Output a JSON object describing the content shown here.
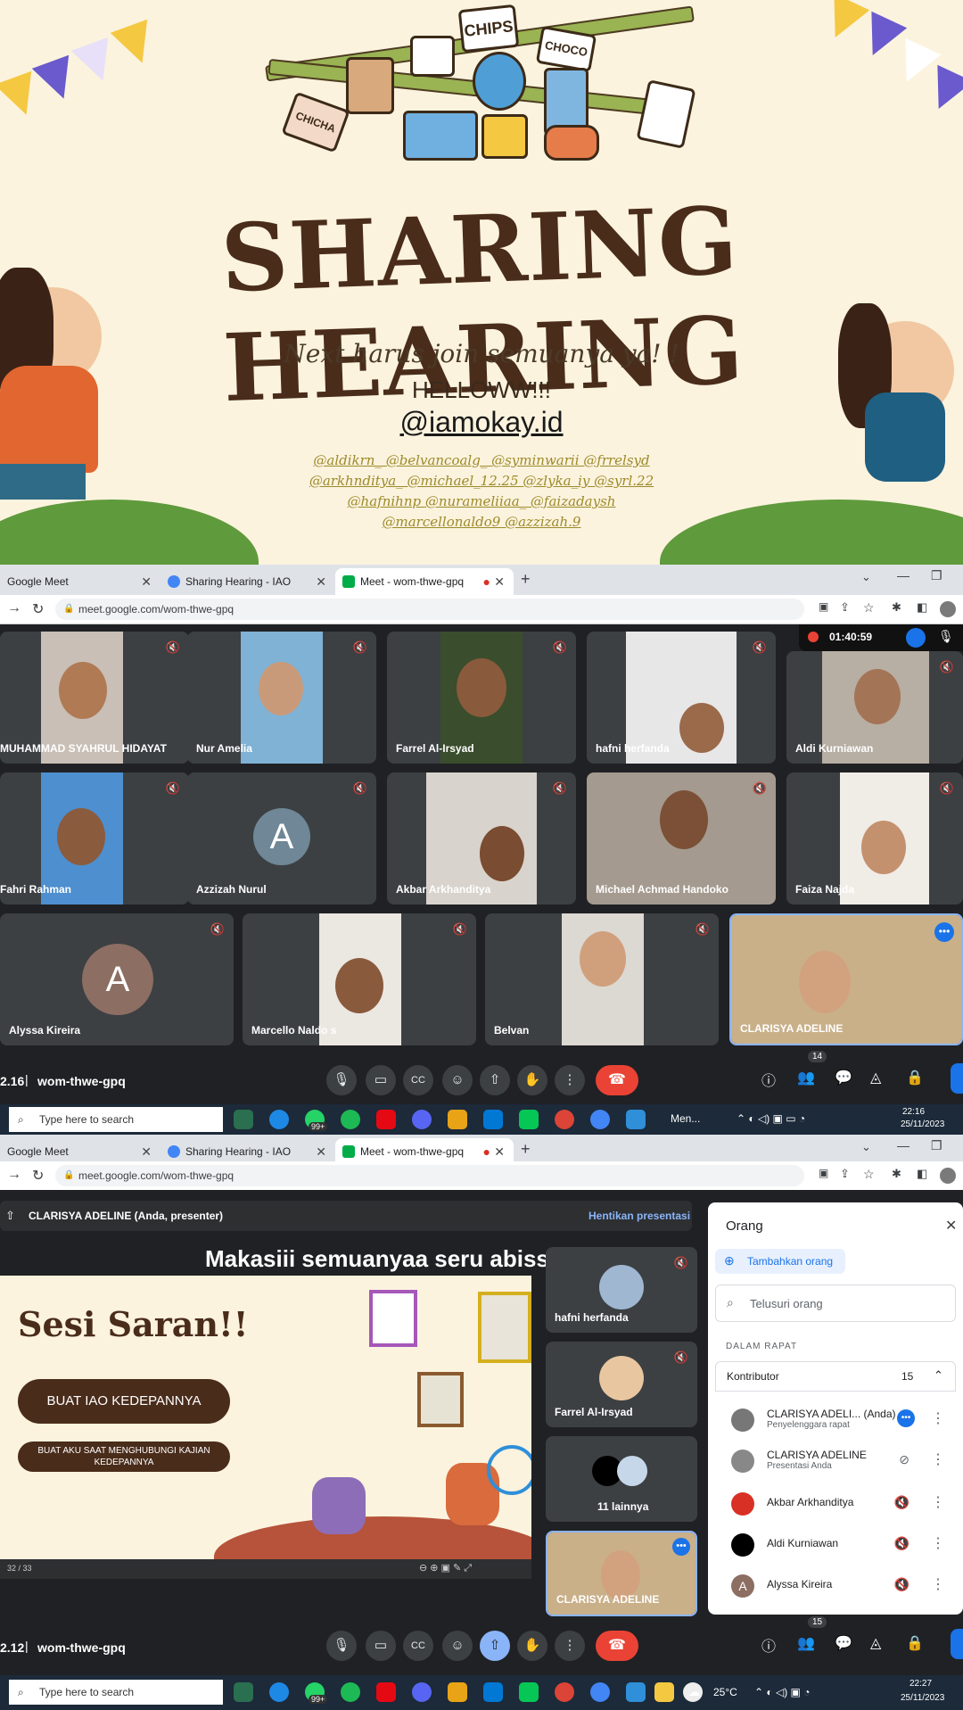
{
  "poster": {
    "title": "SHARING HEARING",
    "subtitle": "Next harus join semuanya ya! !",
    "greeting": "HELLOWW!!!",
    "handle": "@iamokay.id",
    "credits_line1": "@aldikrn_ @belvancoalg_ @syminwarii @frrelsyd",
    "credits_line2": "@arkhnditya_ @michael_12.25 @zlyka_iy @syrl.22",
    "credits_line3": "@hafnihnp @nurameliiaa_ @faizadaysh",
    "credits_line4": "@marcellonaldo9 @azzizah.9",
    "bag_chips": "CHIPS",
    "bag_choco": "CHOCO",
    "bag_chicha": "CHICHA"
  },
  "browser1": {
    "tabs": [
      {
        "label": "Google Meet"
      },
      {
        "label": "Sharing Hearing - IAO"
      },
      {
        "label": "Meet - wom-thwe-gpq"
      }
    ],
    "url": "meet.google.com/wom-thwe-gpq"
  },
  "meet1": {
    "rec_time": "01:40:59",
    "participants": [
      {
        "name": "MUHAMMAD SYAHRUL HIDAYAT"
      },
      {
        "name": "Nur Amelia"
      },
      {
        "name": "Farrel Al-Irsyad"
      },
      {
        "name": "hafni herfanda"
      },
      {
        "name": "Aldi Kurniawan"
      },
      {
        "name": "Fahri Rahman"
      },
      {
        "name": "Azzizah Nurul",
        "initial": "A"
      },
      {
        "name": "Akbar Arkhanditya"
      },
      {
        "name": "Michael Achmad Handoko"
      },
      {
        "name": "Faiza Najda"
      },
      {
        "name": "Alyssa Kireira",
        "initial": "A"
      },
      {
        "name": "Marcello Naldo s"
      },
      {
        "name": "Belvan"
      },
      {
        "name": "CLARISYA ADELINE"
      }
    ],
    "time": "2.16",
    "meeting_code": "wom-thwe-gpq",
    "people_count": "14"
  },
  "taskbar1": {
    "search_placeholder": "Type here to search",
    "app_label": "Men...",
    "badge": "99+",
    "time": "22:16",
    "date": "25/11/2023"
  },
  "browser2": {
    "tabs": [
      {
        "label": "Google Meet"
      },
      {
        "label": "Sharing Hearing - IAO"
      },
      {
        "label": "Meet - wom-thwe-gpq"
      }
    ],
    "url": "meet.google.com/wom-thwe-gpq"
  },
  "meet2": {
    "presenter_label": "CLARISYA ADELINE (Anda, presenter)",
    "stop_presenting": "Hentikan presentasi",
    "caption": "Makasiii semuanyaa seru abisss!!!",
    "slide_title": "Sesi Saran!!",
    "slide_button1": "BUAT IAO KEDEPANNYA",
    "slide_button2": "BUAT AKU SAAT MENGHUBUNGI KAJIAN KEDEPANNYA",
    "slide_page": "32 / 33",
    "side_tiles": [
      {
        "name": "hafni herfanda"
      },
      {
        "name": "Farrel Al-Irsyad"
      },
      {
        "name": "11 lainnya"
      },
      {
        "name": "CLARISYA ADELINE"
      }
    ],
    "time": "2.12",
    "meeting_code": "wom-thwe-gpq",
    "people_count": "15"
  },
  "people_panel": {
    "title": "Orang",
    "add_people": "Tambahkan orang",
    "search_placeholder": "Telusuri orang",
    "section": "DALAM RAPAT",
    "group_label": "Kontributor",
    "group_count": "15",
    "people": [
      {
        "name": "CLARISYA ADELI...  (Anda)",
        "sub": "Penyelenggara rapat"
      },
      {
        "name": "CLARISYA ADELINE",
        "sub": "Presentasi Anda"
      },
      {
        "name": "Akbar Arkhanditya",
        "sub": ""
      },
      {
        "name": "Aldi Kurniawan",
        "sub": ""
      },
      {
        "name": "Alyssa Kireira",
        "sub": ""
      }
    ]
  },
  "taskbar2": {
    "search_placeholder": "Type here to search",
    "badge": "99+",
    "weather": "25°C",
    "time": "22:27",
    "date": "25/11/2023"
  },
  "colors": {
    "poster_bg": "#fbf3de",
    "title_brown": "#4a2c1b",
    "meet_bg": "#202124",
    "tile_bg": "#3c4043",
    "end_call_red": "#ea4335",
    "accent_blue": "#1a73e8"
  }
}
